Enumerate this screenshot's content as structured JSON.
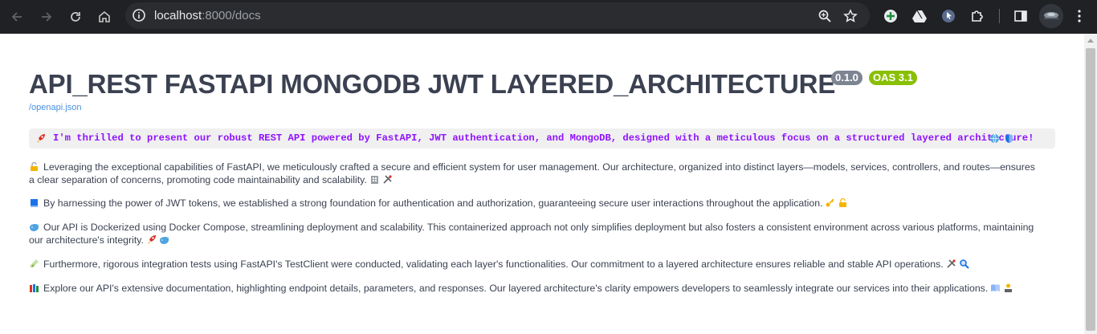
{
  "browser": {
    "url_host": "localhost",
    "url_rest": ":8000/docs"
  },
  "api": {
    "title": "API_REST FASTAPI MONGODB JWT LAYERED_ARCHITECTURE",
    "version": "0.1.0",
    "oas": "OAS 3.1",
    "openapi_link": "/openapi.json",
    "intro": "I'm thrilled to present our robust REST API powered by FastAPI, JWT authentication, and MongoDB, designed with a meticulous focus on a structured layered architecture!",
    "paragraphs": [
      "Leveraging the exceptional capabilities of FastAPI, we meticulously crafted a secure and efficient system for user management. Our architecture, organized into distinct layers—models, services, controllers, and routes—ensures a clear separation of concerns, promoting code maintainability and scalability.",
      "By harnessing the power of JWT tokens, we established a strong foundation for authentication and authorization, guaranteeing secure user interactions throughout the application.",
      "Our API is Dockerized using Docker Compose, streamlining deployment and scalability. This containerized approach not only simplifies deployment but also fosters a consistent environment across various platforms, maintaining our architecture's integrity.",
      "Furthermore, rigorous integration tests using FastAPI's TestClient were conducted, validating each layer's functionalities. Our commitment to a layered architecture ensures reliable and stable API operations.",
      "Explore our API's extensive documentation, highlighting endpoint details, parameters, and responses. Our layered architecture's clarity empowers developers to seamlessly integrate our services into their applications."
    ]
  },
  "icons": {
    "intro_lead": "rocket-icon",
    "intro_trail": [
      "globe-icon",
      "shield-icon"
    ],
    "para_lead": [
      "lock-icon",
      "book-icon",
      "whale-icon",
      "test-tube-icon",
      "books-icon"
    ]
  }
}
